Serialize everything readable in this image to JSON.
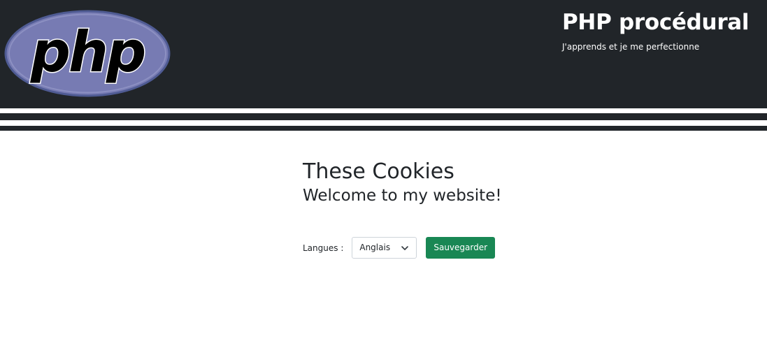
{
  "header": {
    "logo": {
      "icon": "php-logo-icon",
      "text": "php",
      "colors": {
        "ellipse": "#777bb3",
        "ellipse_border": "#4f5b93",
        "text": "#000000",
        "text_outline": "#ffffff"
      }
    },
    "title": "PHP procédural",
    "tagline": "J'apprends et je me perfectionne",
    "background": "#212529"
  },
  "main": {
    "title": "These Cookies",
    "subtitle": "Welcome to my website!",
    "form": {
      "label": "Langues :",
      "select_value": "Anglais",
      "select_icon": "chevron-down-icon",
      "save_label": "Sauvegarder",
      "save_color": "#198754"
    }
  }
}
